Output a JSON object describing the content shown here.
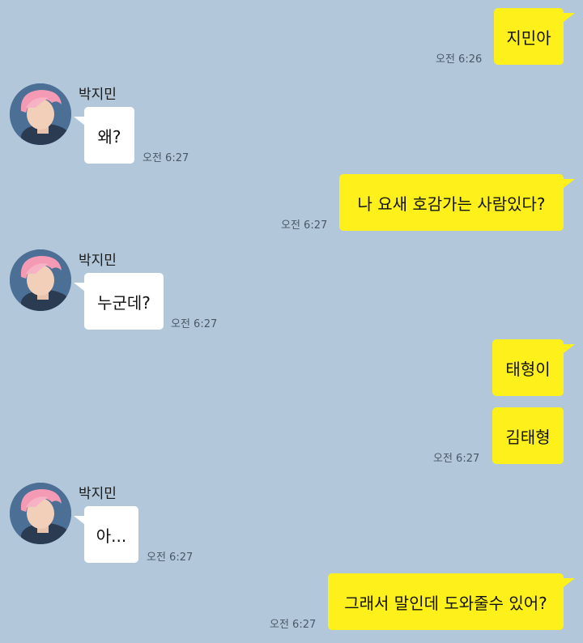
{
  "chat": {
    "contact_name": "박지민",
    "messages": [
      {
        "sender": "me",
        "text": "지민아",
        "time": "오전 6:26"
      },
      {
        "sender": "other",
        "text": "왜?",
        "time": "오전 6:27"
      },
      {
        "sender": "me",
        "text": "나 요새 호감가는 사람있다?",
        "time": "오전 6:27"
      },
      {
        "sender": "other",
        "text": "누군데?",
        "time": "오전 6:27"
      },
      {
        "sender": "me",
        "text": "태형이",
        "time": ""
      },
      {
        "sender": "me",
        "text": "김태형",
        "time": "오전 6:27"
      },
      {
        "sender": "other",
        "text": "아...",
        "time": "오전 6:27"
      },
      {
        "sender": "me",
        "text": "그래서 말인데 도와줄수 있어?",
        "time": "오전 6:27"
      }
    ]
  },
  "colors": {
    "background": "#b2c7da",
    "my_bubble": "#fef01b",
    "other_bubble": "#ffffff"
  },
  "icons": {
    "avatar": "profile-photo-avatar"
  }
}
